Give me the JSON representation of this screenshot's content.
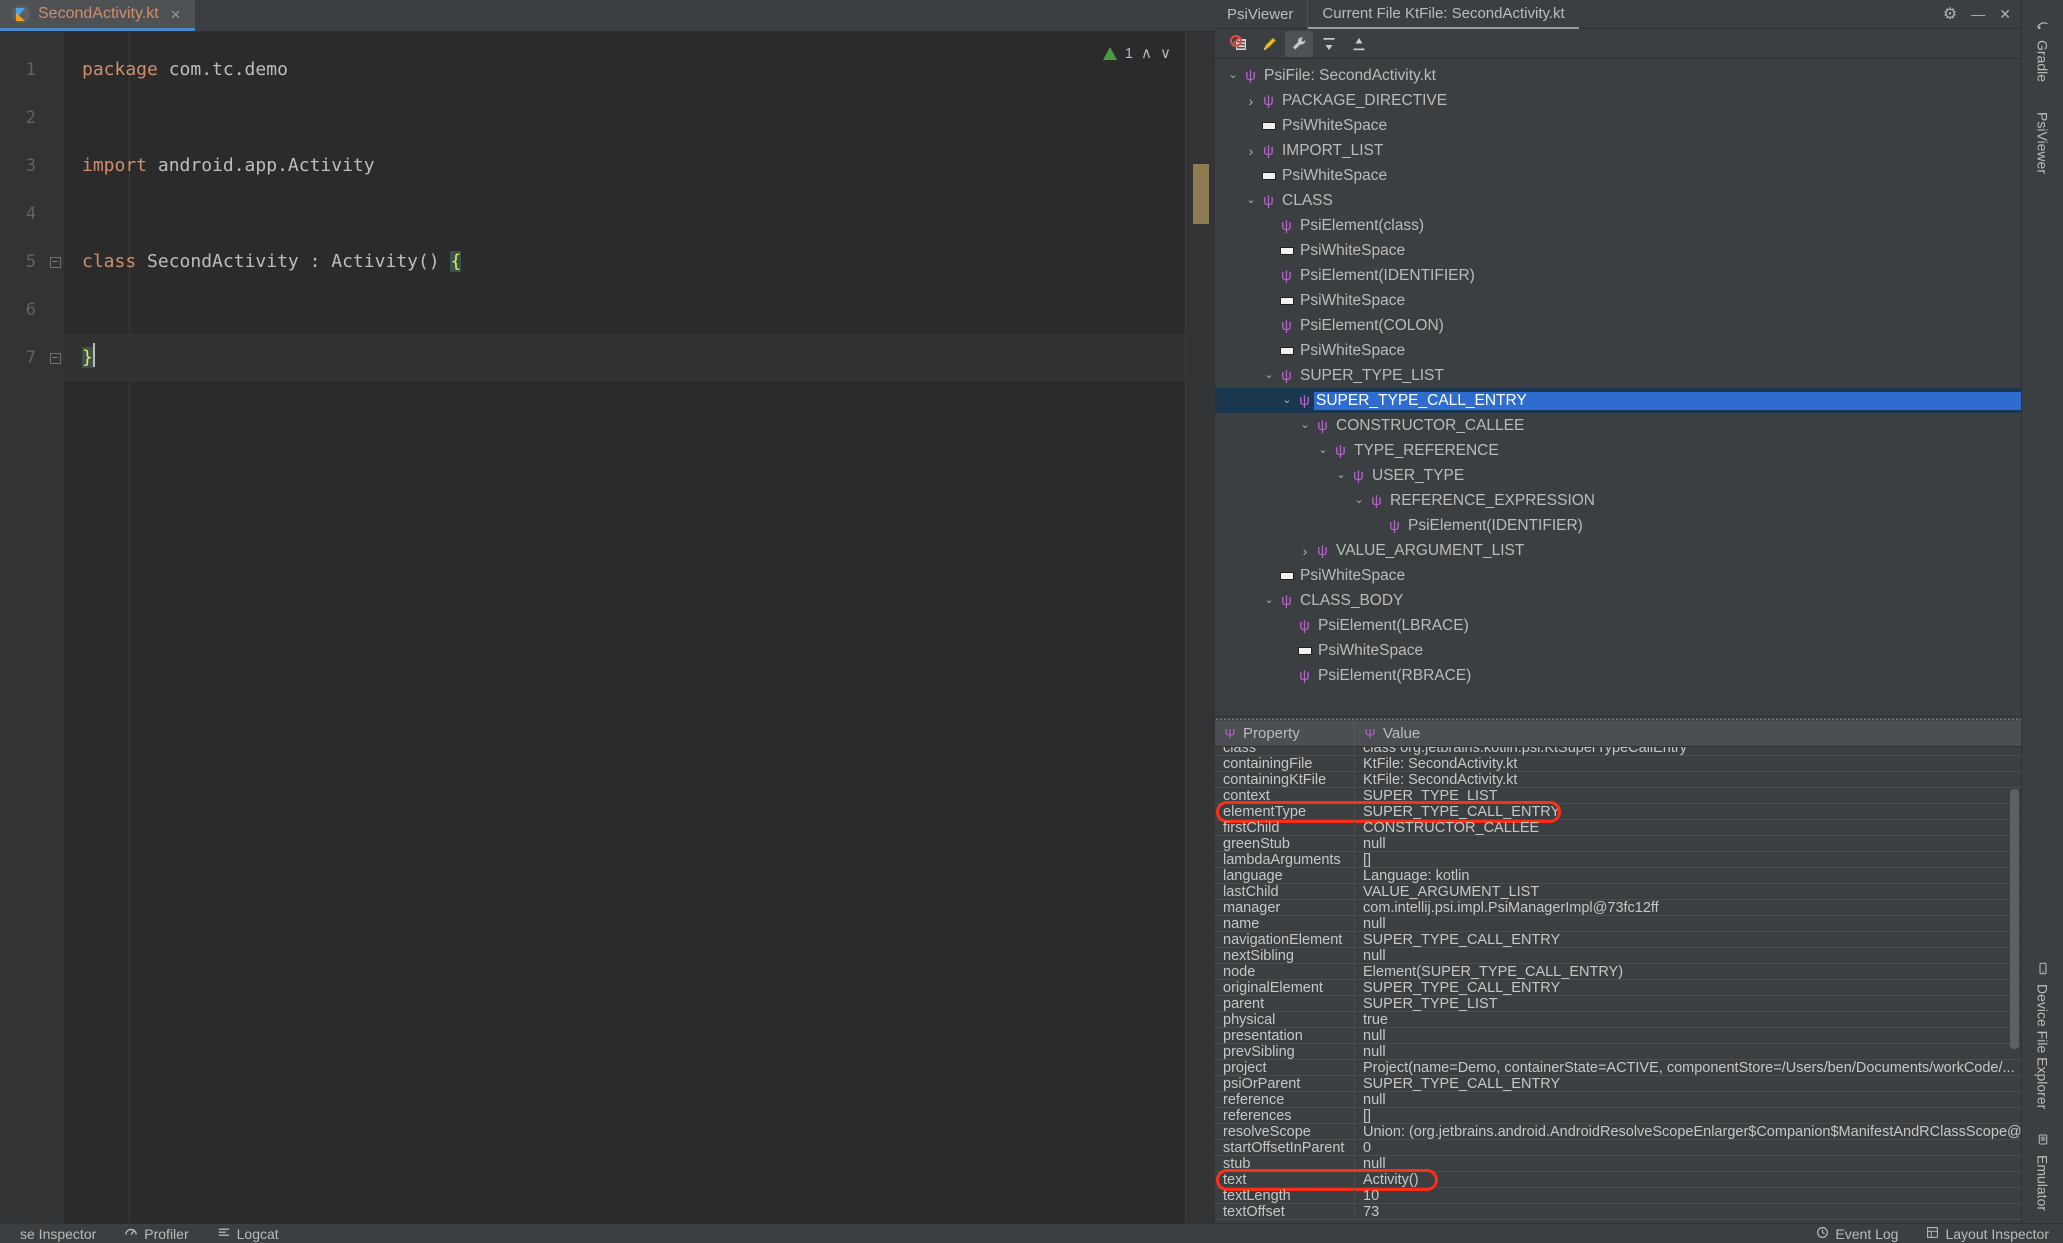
{
  "editor": {
    "tab": {
      "filename": "SecondActivity.kt",
      "icon": "kotlin-file-icon",
      "close": "×"
    },
    "gutter_lines": [
      "1",
      "2",
      "3",
      "4",
      "5",
      "6",
      "7"
    ],
    "code_lines": [
      {
        "n": 1,
        "segments": [
          {
            "t": "package ",
            "c": "kw"
          },
          {
            "t": "com.tc.demo",
            "c": "pl"
          }
        ]
      },
      {
        "n": 2,
        "segments": []
      },
      {
        "n": 3,
        "segments": [
          {
            "t": "import ",
            "c": "kw"
          },
          {
            "t": "android.app.Activity",
            "c": "pl"
          }
        ]
      },
      {
        "n": 4,
        "segments": []
      },
      {
        "n": 5,
        "segments": [
          {
            "t": "class ",
            "c": "kw"
          },
          {
            "t": "SecondActivity : Activity() ",
            "c": "pl"
          },
          {
            "t": "{",
            "c": "brace"
          }
        ]
      },
      {
        "n": 6,
        "segments": []
      },
      {
        "n": 7,
        "segments": [
          {
            "t": "}",
            "c": "brace"
          }
        ]
      }
    ],
    "inspections": {
      "count": "1",
      "up_arrow": "∧",
      "down_arrow": "∨",
      "icon": "inspection-ok-icon"
    }
  },
  "psi_viewer": {
    "title": "PsiViewer",
    "file_tab": "Current File KtFile: SecondActivity.kt",
    "window_buttons": [
      {
        "name": "settings-gear-icon",
        "glyph": "⚙"
      },
      {
        "name": "minimize-icon",
        "glyph": "—"
      },
      {
        "name": "close-icon",
        "glyph": "✕"
      }
    ],
    "toolbar": [
      {
        "name": "block-psi-icon",
        "glyph": "⊘",
        "active": false
      },
      {
        "name": "highlight-brush-icon",
        "glyph": "✎",
        "active": false
      },
      {
        "name": "wrench-settings-icon",
        "glyph": "ὒ7",
        "active": true
      },
      {
        "name": "expand-up-icon",
        "glyph": "↑",
        "active": false
      },
      {
        "name": "collapse-down-icon",
        "glyph": "↓",
        "active": false
      }
    ],
    "tree": [
      {
        "label": "PsiFile: SecondActivity.kt",
        "depth": 0,
        "twisty": "expanded",
        "icon": "psi",
        "selected": false
      },
      {
        "label": "PACKAGE_DIRECTIVE",
        "depth": 1,
        "twisty": "collapsed",
        "icon": "psi",
        "selected": false
      },
      {
        "label": "PsiWhiteSpace",
        "depth": 1,
        "twisty": "none",
        "icon": "ws",
        "selected": false
      },
      {
        "label": "IMPORT_LIST",
        "depth": 1,
        "twisty": "collapsed",
        "icon": "psi",
        "selected": false
      },
      {
        "label": "PsiWhiteSpace",
        "depth": 1,
        "twisty": "none",
        "icon": "ws",
        "selected": false
      },
      {
        "label": "CLASS",
        "depth": 1,
        "twisty": "expanded",
        "icon": "psi",
        "selected": false
      },
      {
        "label": "PsiElement(class)",
        "depth": 2,
        "twisty": "none",
        "icon": "psi",
        "selected": false
      },
      {
        "label": "PsiWhiteSpace",
        "depth": 2,
        "twisty": "none",
        "icon": "ws",
        "selected": false
      },
      {
        "label": "PsiElement(IDENTIFIER)",
        "depth": 2,
        "twisty": "none",
        "icon": "psi",
        "selected": false
      },
      {
        "label": "PsiWhiteSpace",
        "depth": 2,
        "twisty": "none",
        "icon": "ws",
        "selected": false
      },
      {
        "label": "PsiElement(COLON)",
        "depth": 2,
        "twisty": "none",
        "icon": "psi",
        "selected": false
      },
      {
        "label": "PsiWhiteSpace",
        "depth": 2,
        "twisty": "none",
        "icon": "ws",
        "selected": false
      },
      {
        "label": "SUPER_TYPE_LIST",
        "depth": 2,
        "twisty": "expanded",
        "icon": "psi",
        "selected": false
      },
      {
        "label": "SUPER_TYPE_CALL_ENTRY",
        "depth": 3,
        "twisty": "expanded",
        "icon": "psi",
        "selected": true
      },
      {
        "label": "CONSTRUCTOR_CALLEE",
        "depth": 4,
        "twisty": "expanded",
        "icon": "psi",
        "selected": false
      },
      {
        "label": "TYPE_REFERENCE",
        "depth": 5,
        "twisty": "expanded",
        "icon": "psi",
        "selected": false
      },
      {
        "label": "USER_TYPE",
        "depth": 6,
        "twisty": "expanded",
        "icon": "psi",
        "selected": false
      },
      {
        "label": "REFERENCE_EXPRESSION",
        "depth": 7,
        "twisty": "expanded",
        "icon": "psi",
        "selected": false
      },
      {
        "label": "PsiElement(IDENTIFIER)",
        "depth": 8,
        "twisty": "none",
        "icon": "psi",
        "selected": false
      },
      {
        "label": "VALUE_ARGUMENT_LIST",
        "depth": 4,
        "twisty": "collapsed",
        "icon": "psi",
        "selected": false
      },
      {
        "label": "PsiWhiteSpace",
        "depth": 2,
        "twisty": "none",
        "icon": "ws",
        "selected": false
      },
      {
        "label": "CLASS_BODY",
        "depth": 2,
        "twisty": "expanded",
        "icon": "psi",
        "selected": false
      },
      {
        "label": "PsiElement(LBRACE)",
        "depth": 3,
        "twisty": "none",
        "icon": "psi",
        "selected": false
      },
      {
        "label": "PsiWhiteSpace",
        "depth": 3,
        "twisty": "none",
        "icon": "ws",
        "selected": false
      },
      {
        "label": "PsiElement(RBRACE)",
        "depth": 3,
        "twisty": "none",
        "icon": "psi",
        "selected": false
      }
    ],
    "property_table": {
      "headers": {
        "property": "Property",
        "value": "Value"
      },
      "rows": [
        {
          "name": "class",
          "value": "class org.jetbrains.kotlin.psi.KtSuperTypeCallEntry",
          "clipped_top": true,
          "annotated": false
        },
        {
          "name": "containingFile",
          "value": "KtFile: SecondActivity.kt",
          "annotated": false
        },
        {
          "name": "containingKtFile",
          "value": "KtFile: SecondActivity.kt",
          "annotated": false
        },
        {
          "name": "context",
          "value": "SUPER_TYPE_LIST",
          "annotated": false
        },
        {
          "name": "elementType",
          "value": "SUPER_TYPE_CALL_ENTRY",
          "annotated": true
        },
        {
          "name": "firstChild",
          "value": "CONSTRUCTOR_CALLEE",
          "annotated": false
        },
        {
          "name": "greenStub",
          "value": "null",
          "annotated": false
        },
        {
          "name": "lambdaArguments",
          "value": "[]",
          "annotated": false
        },
        {
          "name": "language",
          "value": "Language: kotlin",
          "annotated": false
        },
        {
          "name": "lastChild",
          "value": "VALUE_ARGUMENT_LIST",
          "annotated": false
        },
        {
          "name": "manager",
          "value": "com.intellij.psi.impl.PsiManagerImpl@73fc12ff",
          "annotated": false
        },
        {
          "name": "name",
          "value": "null",
          "annotated": false
        },
        {
          "name": "navigationElement",
          "value": "SUPER_TYPE_CALL_ENTRY",
          "annotated": false
        },
        {
          "name": "nextSibling",
          "value": "null",
          "annotated": false
        },
        {
          "name": "node",
          "value": "Element(SUPER_TYPE_CALL_ENTRY)",
          "annotated": false
        },
        {
          "name": "originalElement",
          "value": "SUPER_TYPE_CALL_ENTRY",
          "annotated": false
        },
        {
          "name": "parent",
          "value": "SUPER_TYPE_LIST",
          "annotated": false
        },
        {
          "name": "physical",
          "value": "true",
          "annotated": false
        },
        {
          "name": "presentation",
          "value": "null",
          "annotated": false
        },
        {
          "name": "prevSibling",
          "value": "null",
          "annotated": false
        },
        {
          "name": "project",
          "value": "Project(name=Demo, containerState=ACTIVE, componentStore=/Users/ben/Documents/workCode/...",
          "annotated": false
        },
        {
          "name": "psiOrParent",
          "value": "SUPER_TYPE_CALL_ENTRY",
          "annotated": false
        },
        {
          "name": "reference",
          "value": "null",
          "annotated": false
        },
        {
          "name": "references",
          "value": "[]",
          "annotated": false
        },
        {
          "name": "resolveScope",
          "value": "Union: (org.jetbrains.android.AndroidResolveScopeEnlarger$Companion$ManifestAndRClassScope@...",
          "annotated": false
        },
        {
          "name": "startOffsetInParent",
          "value": "0",
          "annotated": false
        },
        {
          "name": "stub",
          "value": "null",
          "annotated": false
        },
        {
          "name": "text",
          "value": "Activity()",
          "annotated": true,
          "short": true
        },
        {
          "name": "textLength",
          "value": "10",
          "annotated": false
        },
        {
          "name": "textOffset",
          "value": "73",
          "annotated": false,
          "clipped_bottom": true
        }
      ]
    }
  },
  "right_stripe": [
    {
      "label": "Gradle",
      "icon": "gradle-icon"
    },
    {
      "label": "PsiViewer",
      "icon": "psiviewer-icon"
    },
    {
      "label": "Device File Explorer",
      "icon": "device-file-explorer-icon"
    },
    {
      "label": "Emulator",
      "icon": "emulator-icon"
    }
  ],
  "status_bar": {
    "left_items": [
      {
        "label": "se Inspector",
        "icon": "database-inspector-icon"
      },
      {
        "label": "Profiler",
        "icon": "profiler-icon"
      },
      {
        "label": "Logcat",
        "icon": "logcat-icon"
      }
    ],
    "right_items": [
      {
        "label": "Event Log",
        "icon": "event-log-icon"
      },
      {
        "label": "Layout Inspector",
        "icon": "layout-inspector-icon"
      }
    ]
  },
  "colors": {
    "selection_blue": "#2f6ccf",
    "selection_row_dark": "#1b3750",
    "annotation_red": "#ff2d16",
    "psi_purple": "#b565c9",
    "keyword_orange": "#cf8e6d",
    "tab_underline": "#4a88c7"
  }
}
